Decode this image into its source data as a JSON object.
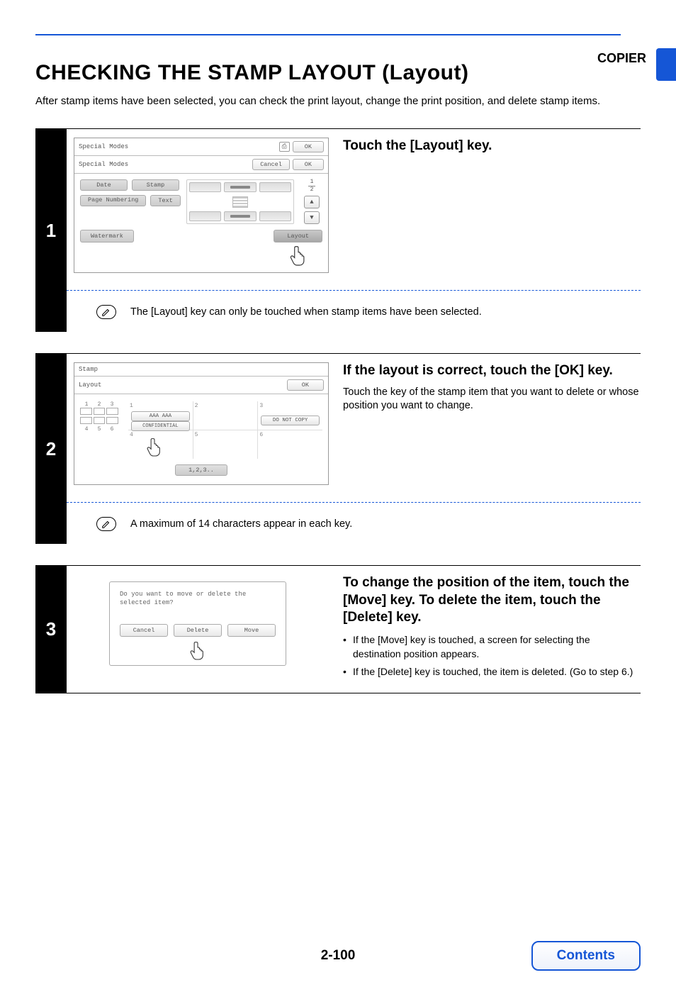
{
  "header": {
    "tab_label": "COPIER"
  },
  "title": "CHECKING THE STAMP LAYOUT (Layout)",
  "intro": "After stamp items have been selected, you can check the print layout, change the print position, and delete stamp items.",
  "steps": {
    "s1": {
      "num": "1",
      "heading": "Touch the [Layout] key.",
      "note": "The [Layout] key can only be touched when stamp items have been selected.",
      "fig": {
        "bar1_title": "Special Modes",
        "bar1_ok": "OK",
        "bar2_title": "Special Modes",
        "bar2_cancel": "Cancel",
        "bar2_ok": "OK",
        "btn_date": "Date",
        "btn_stamp": "Stamp",
        "btn_page": "Page Numbering",
        "btn_text": "Text",
        "btn_watermark": "Watermark",
        "btn_layout": "Layout",
        "page_top": "1",
        "page_bot": "2",
        "arrow_up": "▲",
        "arrow_down": "▼"
      }
    },
    "s2": {
      "num": "2",
      "heading": "If the layout is correct, touch the [OK] key.",
      "desc": "Touch the key of the stamp item that you want to delete or whose position you want to change.",
      "note": "A maximum of 14 characters appear in each key.",
      "fig": {
        "bar1_title": "Stamp",
        "bar2_title": "Layout",
        "bar2_ok": "OK",
        "cells": {
          "c1": "1",
          "c2": "2",
          "c3": "3",
          "c4": "4",
          "c5": "5",
          "c6": "6"
        },
        "cell1_a": "AAA AAA",
        "cell1_b": "CONFIDENTIAL",
        "cell3_a": "DO NOT COPY",
        "bottom_btn": "1,2,3..",
        "diag_top": [
          "1",
          "2",
          "3"
        ],
        "diag_bot": [
          "4",
          "5",
          "6"
        ]
      }
    },
    "s3": {
      "num": "3",
      "heading": "To change the position of the item, touch the [Move] key. To delete the item, touch the [Delete] key.",
      "bullets": [
        "If the [Move] key is touched, a screen for selecting the destination position appears.",
        "If the [Delete] key is touched, the item is deleted. (Go to step 6.)"
      ],
      "fig": {
        "msg": "Do you want to move or delete the selected item?",
        "btn_cancel": "Cancel",
        "btn_delete": "Delete",
        "btn_move": "Move"
      }
    }
  },
  "footer": {
    "page_num": "2-100",
    "contents": "Contents"
  }
}
